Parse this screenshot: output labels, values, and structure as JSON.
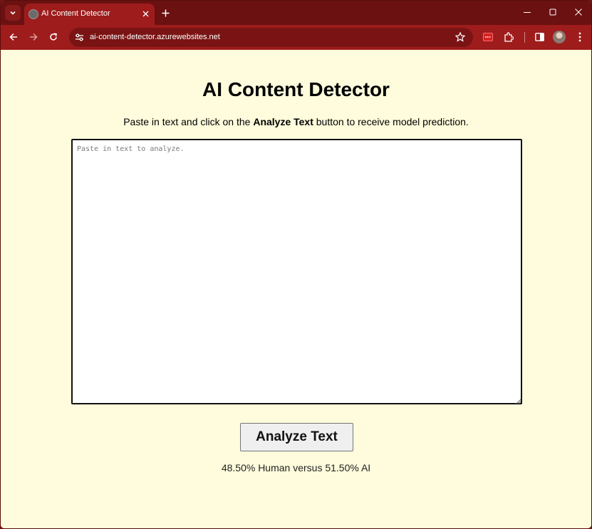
{
  "browser": {
    "tab_title": "AI Content Detector",
    "url": "ai-content-detector.azurewebsites.net",
    "colors": {
      "frame": "#6b1111",
      "toolbar": "#9e1c1c",
      "page_bg": "#fefcdc"
    }
  },
  "icons": {
    "tab_search": "chevron-down-icon",
    "favicon": "globe-icon",
    "tab_close": "close-icon",
    "new_tab": "plus-icon",
    "back": "arrow-left-icon",
    "forward": "arrow-right-icon",
    "reload": "reload-icon",
    "site_info": "tune-icon",
    "bookmark": "star-icon",
    "extension": "extension-icon",
    "puzzle": "puzzle-icon",
    "side_panel": "side-panel-icon",
    "menu": "kebab-menu-icon"
  },
  "page": {
    "title": "AI Content Detector",
    "subtitle_before": "Paste in text and click on the ",
    "subtitle_bold": "Analyze Text",
    "subtitle_after": " button to receive model prediction.",
    "textarea_placeholder": "Paste in text to analyze.",
    "textarea_value": "",
    "analyze_button_label": "Analyze Text",
    "result_text": "48.50% Human versus 51.50% AI"
  }
}
